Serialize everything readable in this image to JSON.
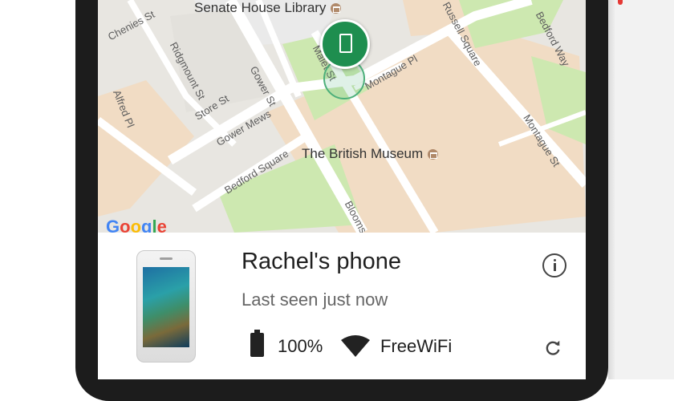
{
  "map": {
    "streets": [
      "Chenies St",
      "Ridgmount St",
      "Gower St",
      "Alfred Pl",
      "Store St",
      "Gower Mews",
      "Bedford Square",
      "Malet St",
      "Montague Pl",
      "Montague St",
      "Bedford Way",
      "Russell Square",
      "Blooms"
    ],
    "landmarks": {
      "library": "Senate House Library",
      "museum": "The British Museum"
    },
    "logo": "Google",
    "colors": {
      "land": "#e8e6e1",
      "building": "#f1dcc4",
      "park": "#cde8b0",
      "road": "#ffffff"
    }
  },
  "device": {
    "name": "Rachel's phone",
    "status": "Last seen just now",
    "battery": "100%",
    "network": "FreeWiFi",
    "marker_color": "#1e8e4f"
  },
  "icons": [
    "museum-icon",
    "library-icon",
    "device-marker-icon",
    "info-icon",
    "battery-icon",
    "wifi-icon",
    "refresh-icon"
  ]
}
